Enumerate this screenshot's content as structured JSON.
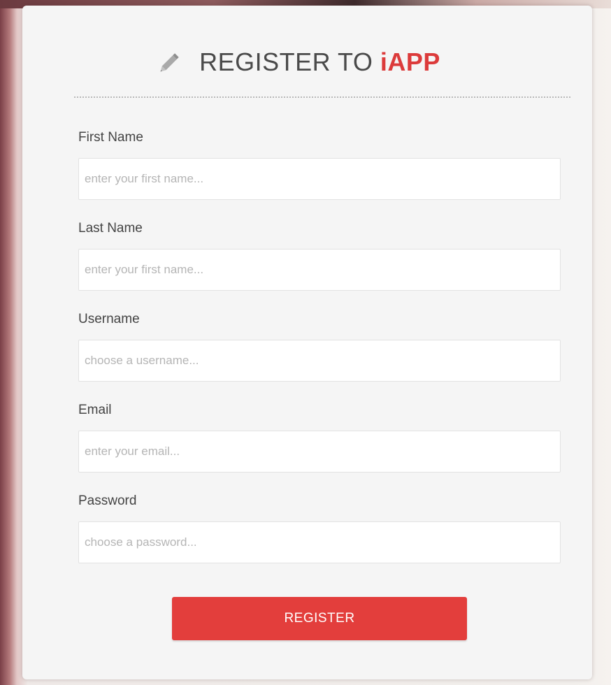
{
  "header": {
    "title_prefix": "REGISTER TO ",
    "title_brand": "iAPP",
    "icon": "pencil-icon",
    "brand_color": "#dc3b3b"
  },
  "form": {
    "fields": [
      {
        "label": "First Name",
        "placeholder": "enter your first name...",
        "value": ""
      },
      {
        "label": "Last Name",
        "placeholder": "enter your first name...",
        "value": ""
      },
      {
        "label": "Username",
        "placeholder": "choose a username...",
        "value": ""
      },
      {
        "label": "Email",
        "placeholder": "enter your email...",
        "value": ""
      },
      {
        "label": "Password",
        "placeholder": "choose a password...",
        "value": ""
      }
    ],
    "submit_label": "REGISTER",
    "submit_color": "#e33e3c"
  }
}
